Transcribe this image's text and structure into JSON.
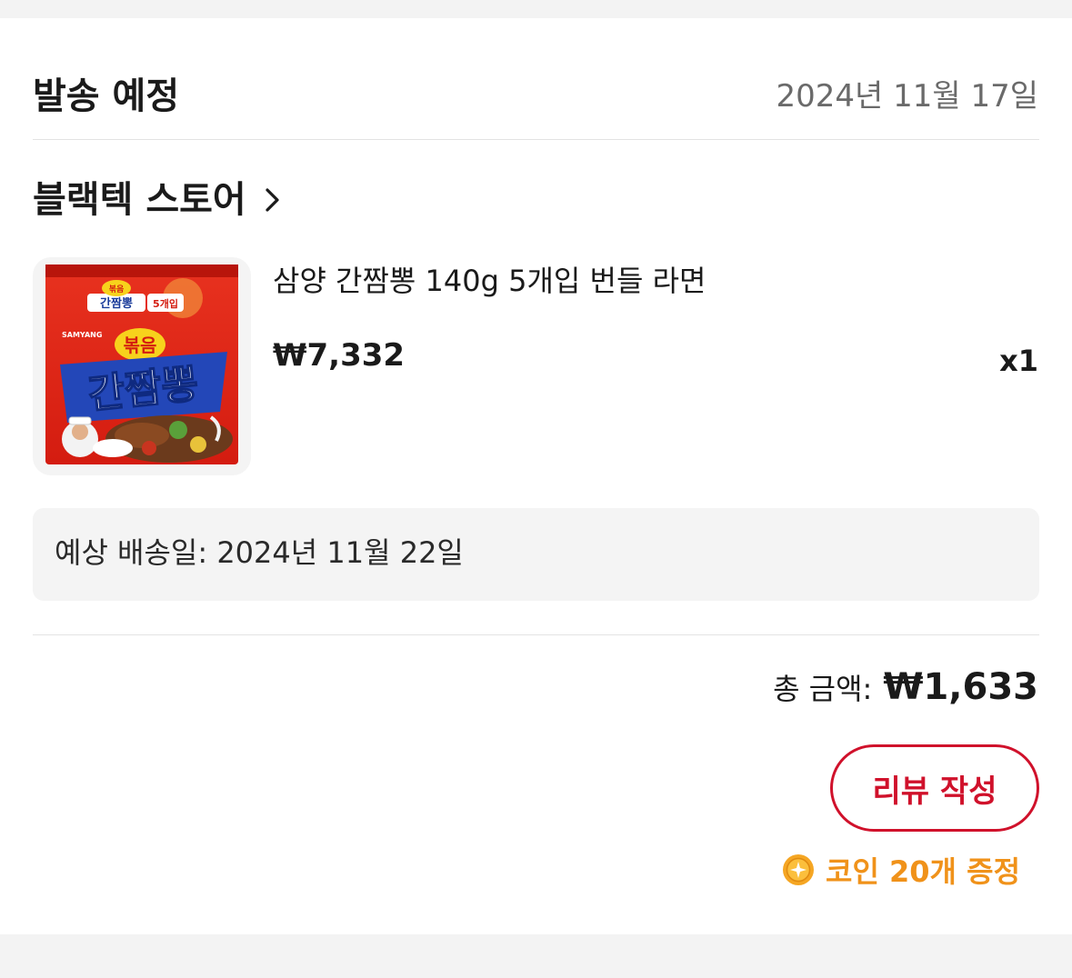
{
  "header": {
    "title": "발송 예정",
    "date": "2024년 11월 17일"
  },
  "store": {
    "name": "블랙텍 스토어",
    "chevron_icon": "chevron-right-icon"
  },
  "product": {
    "name": "삼양 간짬뽕 140g 5개입 번들 라면",
    "price": "₩7,332",
    "quantity": "x1",
    "package_text": {
      "badge": "볶음",
      "top_label": "간짬뽕",
      "count_label": "5개입",
      "brand": "SAMYANG",
      "main_label": "간짬뽕"
    }
  },
  "delivery": {
    "estimated": "예상 배송일: 2024년 11월 22일"
  },
  "total": {
    "label": "총 금액:",
    "value": "₩1,633"
  },
  "actions": {
    "review_label": "리뷰 작성"
  },
  "reward": {
    "icon": "coin-icon",
    "text": "코인 20개 증정"
  },
  "colors": {
    "accent_red": "#d0112b",
    "coin_orange": "#f0921a",
    "muted_text": "#6a6a6a",
    "surface_gray": "#f4f4f4"
  }
}
